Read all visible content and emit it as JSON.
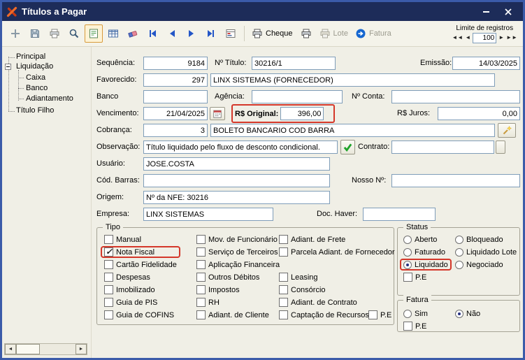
{
  "window": {
    "title": "Títulos a Pagar"
  },
  "colors": {
    "annotation_highlight": "#d4372a",
    "titlebar": "#1d2c59",
    "nav_accent": "#2356c7"
  },
  "toolbar": {
    "cheque": "Cheque",
    "lote": "Lote",
    "fatura": "Fatura",
    "limit_label": "Limite de registros",
    "limit_value": "100"
  },
  "tree": {
    "principal": "Principal",
    "liquidacao": "Liquidação",
    "caixa": "Caixa",
    "banco": "Banco",
    "adiantamento": "Adiantamento",
    "titulo_filho": "Título Filho"
  },
  "fields": {
    "sequencia": {
      "label": "Sequência:",
      "value": "9184"
    },
    "num_titulo": {
      "label": "Nº Título:",
      "value": "30216/1"
    },
    "emissao": {
      "label": "Emissão:",
      "value": "14/03/2025"
    },
    "favorecido": {
      "label": "Favorecido:",
      "code": "297",
      "name": "LINX SISTEMAS (FORNECEDOR)"
    },
    "banco": {
      "label": "Banco",
      "value": ""
    },
    "agencia": {
      "label": "Agência:",
      "value": ""
    },
    "num_conta": {
      "label": "Nº Conta:",
      "value": ""
    },
    "vencimento": {
      "label": "Vencimento:",
      "value": "21/04/2025"
    },
    "original": {
      "label": "R$ Original:",
      "value": "396,00"
    },
    "juros": {
      "label": "R$ Juros:",
      "value": "0,00"
    },
    "cobranca": {
      "label": "Cobrança:",
      "code": "3",
      "name": "BOLETO BANCARIO COD BARRA"
    },
    "observacao": {
      "label": "Observação:",
      "value": "Título liquidado pelo fluxo de desconto condicional."
    },
    "contrato": {
      "label": "Contrato:",
      "value": ""
    },
    "usuario": {
      "label": "Usuário:",
      "value": "JOSE.COSTA"
    },
    "cod_barras": {
      "label": "Cód. Barras:",
      "value": ""
    },
    "nosso_num": {
      "label": "Nosso Nº:",
      "value": ""
    },
    "origem": {
      "label": "Origem:",
      "value": "Nº da NFE: 30216"
    },
    "empresa": {
      "label": "Empresa:",
      "value": "LINX SISTEMAS"
    },
    "doc_haver": {
      "label": "Doc. Haver:",
      "value": ""
    }
  },
  "tipo": {
    "title": "Tipo",
    "col1": [
      {
        "label": "Manual",
        "checked": false
      },
      {
        "label": "Nota Fiscal",
        "checked": true
      },
      {
        "label": "Cartão Fidelidade",
        "checked": false
      },
      {
        "label": "Despesas",
        "checked": false
      },
      {
        "label": "Imobilizado",
        "checked": false
      },
      {
        "label": "Guia de PIS",
        "checked": false
      },
      {
        "label": "Guia de COFINS",
        "checked": false
      }
    ],
    "col2": [
      {
        "label": "Mov. de Funcionário",
        "checked": false
      },
      {
        "label": "Serviço de Terceiros",
        "checked": false
      },
      {
        "label": "Aplicação Financeira",
        "checked": false
      },
      {
        "label": "Outros Débitos",
        "checked": false
      },
      {
        "label": "Impostos",
        "checked": false
      },
      {
        "label": "RH",
        "checked": false
      },
      {
        "label": "Adiant. de Cliente",
        "checked": false
      }
    ],
    "col3": [
      {
        "label": "Adiant. de Frete",
        "checked": false
      },
      {
        "label": "Parcela Adiant. de Fornecedor",
        "checked": false
      },
      {
        "label": "Leasing",
        "checked": false
      },
      {
        "label": "Consórcio",
        "checked": false
      },
      {
        "label": "Adiant. de Contrato",
        "checked": false
      },
      {
        "label": "Captação de Recursos",
        "checked": false
      }
    ],
    "pe": {
      "label": "P.E",
      "checked": false
    }
  },
  "status": {
    "title": "Status",
    "aberto": {
      "label": "Aberto",
      "selected": false
    },
    "bloqueado": {
      "label": "Bloqueado",
      "selected": false
    },
    "faturado": {
      "label": "Faturado",
      "selected": false
    },
    "liquidado_lote": {
      "label": "Liquidado Lote",
      "selected": false
    },
    "liquidado": {
      "label": "Liquidado",
      "selected": true
    },
    "negociado": {
      "label": "Negociado",
      "selected": false
    },
    "pe": {
      "label": "P.E",
      "checked": false
    }
  },
  "fatura": {
    "title": "Fatura",
    "sim": {
      "label": "Sim",
      "selected": false
    },
    "nao": {
      "label": "Não",
      "selected": true
    },
    "pe": {
      "label": "P.E",
      "checked": false
    }
  }
}
